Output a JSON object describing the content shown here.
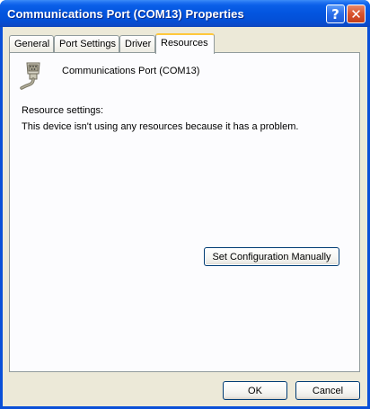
{
  "window": {
    "title": "Communications Port (COM13) Properties",
    "help_glyph": "?",
    "close_glyph": "✕"
  },
  "tabs": [
    {
      "label": "General",
      "active": false
    },
    {
      "label": "Port Settings",
      "active": false
    },
    {
      "label": "Driver",
      "active": false
    },
    {
      "label": "Resources",
      "active": true
    }
  ],
  "panel": {
    "device_icon": "serial-port-icon",
    "device_name": "Communications Port (COM13)",
    "resource_settings_label": "Resource settings:",
    "resource_message": "This device isn't using any resources because it has a problem.",
    "set_config_button": "Set Configuration Manually"
  },
  "footer": {
    "ok_label": "OK",
    "cancel_label": "Cancel"
  },
  "colors": {
    "title_bar": "#0355e0",
    "dialog_bg": "#ece9d8",
    "tab_highlight": "#ffc83c"
  }
}
